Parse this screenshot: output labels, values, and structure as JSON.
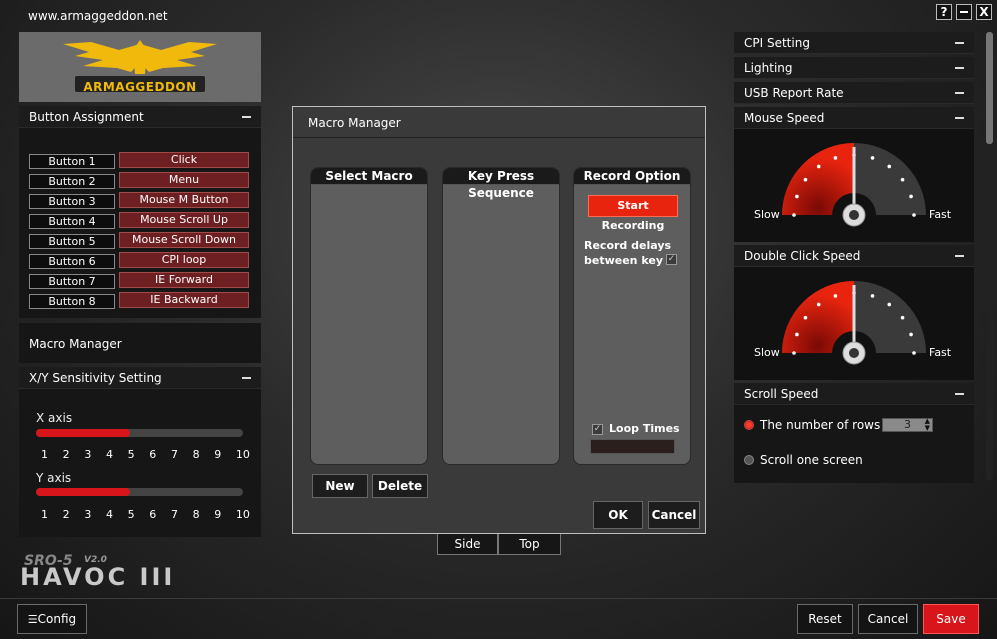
{
  "window": {
    "site_url": "www.armaggeddon.net",
    "help_label": "?",
    "minimize_label": "",
    "close_label": "X"
  },
  "brand": {
    "logo_text": "ARMAGGEDDON",
    "product_line": "SRO-5",
    "product_version": "V2.0",
    "product_name": "HAVOC III",
    "logo_color": "#f0b90b"
  },
  "button_assignment": {
    "title": "Button Assignment",
    "rows": [
      {
        "button": "Button 1",
        "function": "Click"
      },
      {
        "button": "Button 2",
        "function": "Menu"
      },
      {
        "button": "Button 3",
        "function": "Mouse M Button"
      },
      {
        "button": "Button 4",
        "function": "Mouse Scroll Up"
      },
      {
        "button": "Button 5",
        "function": "Mouse Scroll Down"
      },
      {
        "button": "Button 6",
        "function": "CPI loop"
      },
      {
        "button": "Button 7",
        "function": "IE Forward"
      },
      {
        "button": "Button 8",
        "function": "IE Backward"
      }
    ]
  },
  "macro_manager_link": "Macro Manager",
  "sensitivity": {
    "title": "X/Y Sensitivity Setting",
    "x_label": "X axis",
    "y_label": "Y axis",
    "ticks": [
      "1",
      "2",
      "3",
      "4",
      "5",
      "6",
      "7",
      "8",
      "9",
      "10"
    ],
    "x_value": 5,
    "y_value": 5,
    "fill_color": "#d8151a"
  },
  "macro_dialog": {
    "title": "Macro Manager",
    "select_macro_header": "Select Macro",
    "key_sequence_header": "Key Press Sequence",
    "record_option_header": "Record Option",
    "start_recording": "Start Recording",
    "record_delays_line1": "Record delays",
    "record_delays_line2": "between key",
    "record_delays_checked": true,
    "loop_times_label": "Loop Times",
    "loop_times_checked": true,
    "loop_times_value": "",
    "new_label": "New",
    "delete_label": "Delete",
    "ok_label": "OK",
    "cancel_label": "Cancel"
  },
  "view_tabs": {
    "side": "Side",
    "top": "Top"
  },
  "right_panel": {
    "cpi_setting": "CPI Setting",
    "lighting": "Lighting",
    "usb_report_rate": "USB Report Rate",
    "mouse_speed": {
      "title": "Mouse Speed",
      "slow": "Slow",
      "fast": "Fast",
      "level": 0.5
    },
    "double_click_speed": {
      "title": "Double Click Speed",
      "slow": "Slow",
      "fast": "Fast",
      "level": 0.5
    },
    "scroll_speed": {
      "title": "Scroll Speed",
      "rows_option": "The number of rows",
      "rows_value": "3",
      "rows_selected": true,
      "screen_option": "Scroll one screen",
      "screen_selected": false
    },
    "gauge_color": "#e8240f"
  },
  "footer": {
    "config_label": "Config",
    "reset_label": "Reset",
    "cancel_label": "Cancel",
    "save_label": "Save",
    "save_color": "#d8151a"
  }
}
